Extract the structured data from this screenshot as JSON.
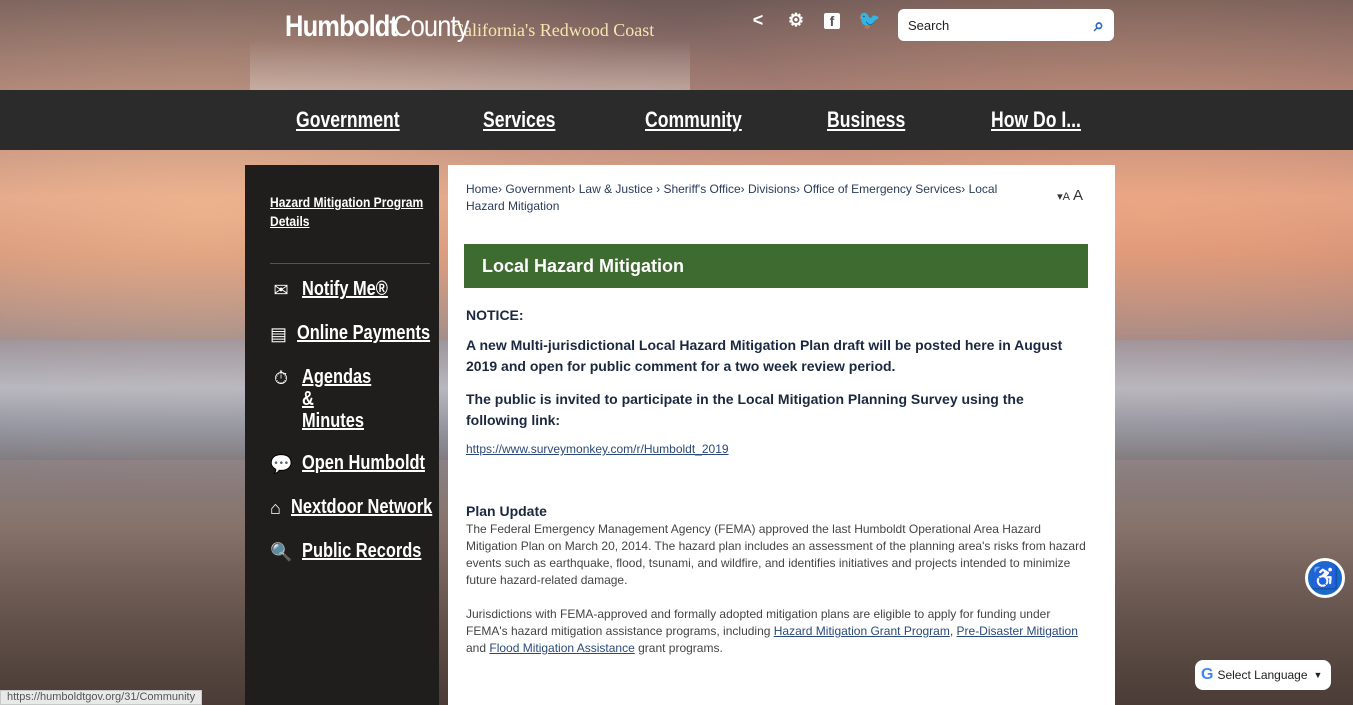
{
  "header": {
    "logo_part1": "Humboldt",
    "logo_part2": "County",
    "tagline": "California's Redwood Coast",
    "search_placeholder": "Search",
    "social_icons": [
      "share-icon",
      "gear-icon",
      "facebook-icon",
      "twitter-icon"
    ]
  },
  "nav": {
    "items": [
      "Government",
      "Services",
      "Community",
      "Business",
      "How Do I..."
    ]
  },
  "sidebar": {
    "program_link": "Hazard Mitigation Program Details",
    "items": [
      {
        "icon": "envelope-icon",
        "label": "Notify Me®"
      },
      {
        "icon": "payment-icon",
        "label": "Online Payments"
      },
      {
        "icon": "stopwatch-icon",
        "label": "Agendas & Minutes"
      },
      {
        "icon": "chat-icon",
        "label": "Open Humboldt"
      },
      {
        "icon": "house-icon",
        "label": "Nextdoor Network"
      },
      {
        "icon": "magnifier-icon",
        "label": "Public Records"
      }
    ]
  },
  "breadcrumb": [
    "Home",
    "Government",
    "Law & Justice",
    "Sheriff's Office",
    "Divisions",
    "Office of Emergency Services",
    "Local Hazard Mitigation"
  ],
  "resize": {
    "small": "A",
    "large": "A"
  },
  "main": {
    "title": "Local Hazard Mitigation",
    "notice": "NOTICE:",
    "para1": "A new Multi-jurisdictional Local Hazard Mitigation Plan draft will be posted here in August 2019 and open for public comment for a two week review period.",
    "para2": "The public is invited to participate in the Local Mitigation Planning Survey using the following link:",
    "survey_link": "https://www.surveymonkey.com/r/Humboldt_2019",
    "plan_update_heading": "Plan Update",
    "plan_update_text": "The Federal Emergency Management Agency (FEMA) approved the last Humboldt Operational Area Hazard Mitigation Plan on March 20, 2014. The hazard plan includes an assessment of the planning area's risks from hazard events such as earthquake, flood, tsunami, and wildfire, and identifies initiatives and projects intended to minimize future hazard-related damage.",
    "juris_text_start": "Jurisdictions with FEMA-approved and formally adopted mitigation plans are eligible to apply for funding under FEMA's hazard mitigation assistance programs, including ",
    "juris_link1": "Hazard Mitigation Grant Program",
    "juris_sep1": ", ",
    "juris_link2": "Pre-Disaster Mitigation ",
    "juris_sep2": "and ",
    "juris_link3": "Flood Mitigation Assistance",
    "juris_text_end": " grant programs."
  },
  "translate": {
    "label": "Select Language"
  },
  "statusbar": {
    "url": "https://humboldtgov.org/31/Community"
  }
}
